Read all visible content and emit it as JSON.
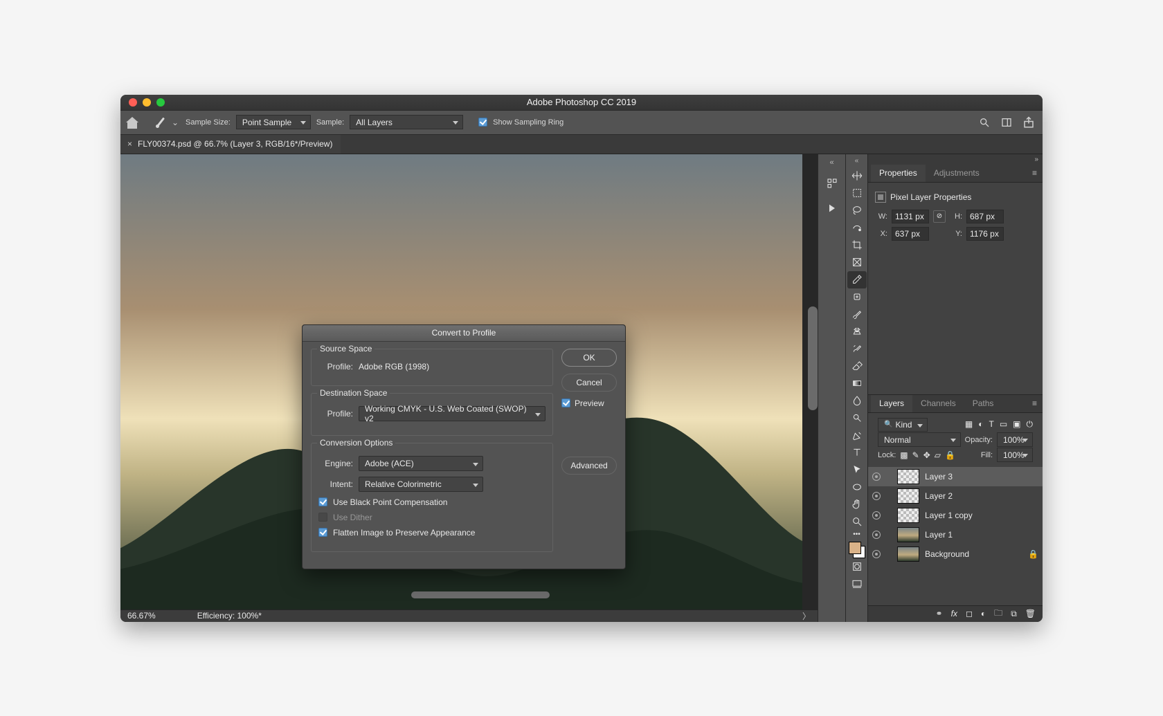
{
  "window": {
    "title": "Adobe Photoshop CC 2019"
  },
  "optionsBar": {
    "sampleSizeLabel": "Sample Size:",
    "sampleSizeValue": "Point Sample",
    "sampleLabel": "Sample:",
    "sampleValue": "All Layers",
    "showSamplingRing": "Show Sampling Ring"
  },
  "document": {
    "tabTitle": "FLY00374.psd @ 66.7% (Layer 3, RGB/16*/Preview)"
  },
  "status": {
    "zoom": "66.67%",
    "efficiency": "Efficiency: 100%*"
  },
  "propertiesPanel": {
    "tabs": {
      "properties": "Properties",
      "adjustments": "Adjustments"
    },
    "header": "Pixel Layer Properties",
    "labels": {
      "w": "W:",
      "h": "H:",
      "x": "X:",
      "y": "Y:"
    },
    "w": "1131 px",
    "h": "687 px",
    "x": "637 px",
    "y": "1176 px"
  },
  "layersPanel": {
    "tabs": {
      "layers": "Layers",
      "channels": "Channels",
      "paths": "Paths"
    },
    "kind": "Kind",
    "blend": "Normal",
    "opacityLbl": "Opacity:",
    "opacity": "100%",
    "lockLbl": "Lock:",
    "fillLbl": "Fill:",
    "fill": "100%",
    "layers": [
      {
        "name": "Layer 3",
        "sel": true,
        "thumb": "checker"
      },
      {
        "name": "Layer 2",
        "thumb": "checker"
      },
      {
        "name": "Layer 1 copy",
        "thumb": "checker"
      },
      {
        "name": "Layer 1",
        "thumb": "img"
      },
      {
        "name": "Background",
        "thumb": "img",
        "locked": true
      }
    ]
  },
  "dialog": {
    "title": "Convert to Profile",
    "sourceSpace": {
      "legend": "Source Space",
      "profileLabel": "Profile:",
      "profile": "Adobe RGB (1998)"
    },
    "destSpace": {
      "legend": "Destination Space",
      "profileLabel": "Profile:",
      "profile": "Working CMYK - U.S. Web Coated (SWOP) v2"
    },
    "options": {
      "legend": "Conversion Options",
      "engineLabel": "Engine:",
      "engine": "Adobe (ACE)",
      "intentLabel": "Intent:",
      "intent": "Relative Colorimetric",
      "blackPoint": "Use Black Point Compensation",
      "dither": "Use Dither",
      "flatten": "Flatten Image to Preserve Appearance"
    },
    "buttons": {
      "ok": "OK",
      "cancel": "Cancel",
      "advanced": "Advanced"
    },
    "preview": "Preview"
  }
}
